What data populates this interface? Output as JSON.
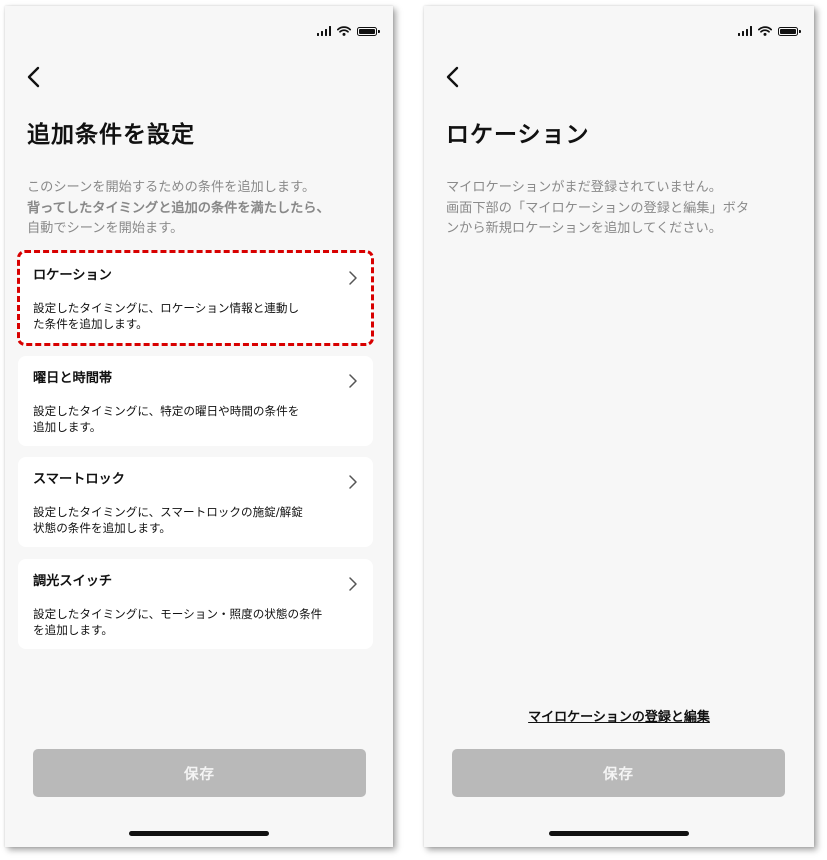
{
  "left_screen": {
    "title": "追加条件を設定",
    "intro_line1": "このシーンを開始するための条件を追加します。",
    "intro_bold": "背ってしたタイミングと追加の条件を満たしたら、",
    "intro_line3": "自動でシーンを開始ます。",
    "cards": [
      {
        "title": "ロケーション",
        "desc": "設定したタイミングに、ロケーション情報と連動し\nた条件を追加します。"
      },
      {
        "title": "曜日と時間帯",
        "desc": "設定したタイミングに、特定の曜日や時間の条件を\n追加します。"
      },
      {
        "title": "スマートロック",
        "desc": "設定したタイミングに、スマートロックの施錠/解錠\n状態の条件を追加します。"
      },
      {
        "title": "調光スイッチ",
        "desc": "設定したタイミングに、モーション・照度の状態の条件\nを追加します。"
      }
    ],
    "save_label": "保存"
  },
  "right_screen": {
    "title": "ロケーション",
    "message_line1": "マイロケーションがまだ登録されていません。",
    "message_line2": "画面下部の「マイロケーションの登録と編集」ボタ",
    "message_line3": "ンから新規ロケーションを追加してください。",
    "link_label": "マイロケーションの登録と編集",
    "save_label": "保存"
  },
  "icons": {
    "status": [
      "signal-icon",
      "wifi-icon",
      "battery-icon"
    ],
    "back": "back-arrow-icon",
    "card_chevron": "chevron-right-icon"
  },
  "colors": {
    "highlight": "#d80000",
    "save_disabled": "#b9b9b9",
    "background": "#f7f7f7"
  }
}
